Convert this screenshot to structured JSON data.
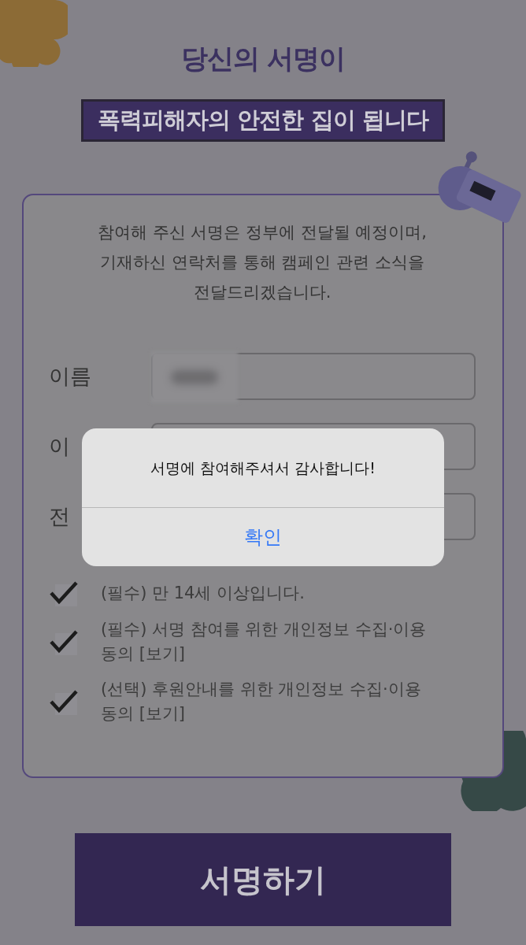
{
  "heading": "당신의 서명이",
  "banner": "폭력피해자의 안전한 집이 됩니다",
  "intro": "참여해 주신 서명은 정부에 전달될 예정이며, 기재하신 연락처를 통해 캠페인 관련 소식을 전달드리겠습니다.",
  "fields": [
    {
      "label": "이름",
      "kind": "redacted"
    },
    {
      "label": "이",
      "kind": "plain"
    },
    {
      "label": "전",
      "kind": "plain"
    }
  ],
  "consents": [
    {
      "text": "(필수) 만 14세 이상입니다.",
      "checked": true
    },
    {
      "text": "(필수) 서명 참여를 위한 개인정보 수집·이용 동의 [보기]",
      "checked": true
    },
    {
      "text": "(선택) 후원안내를 위한 개인정보 수집·이용 동의 [보기]",
      "checked": true
    }
  ],
  "submit": "서명하기",
  "alert": {
    "message": "서명에 참여해주셔서 감사합니다!",
    "button": "확인"
  }
}
